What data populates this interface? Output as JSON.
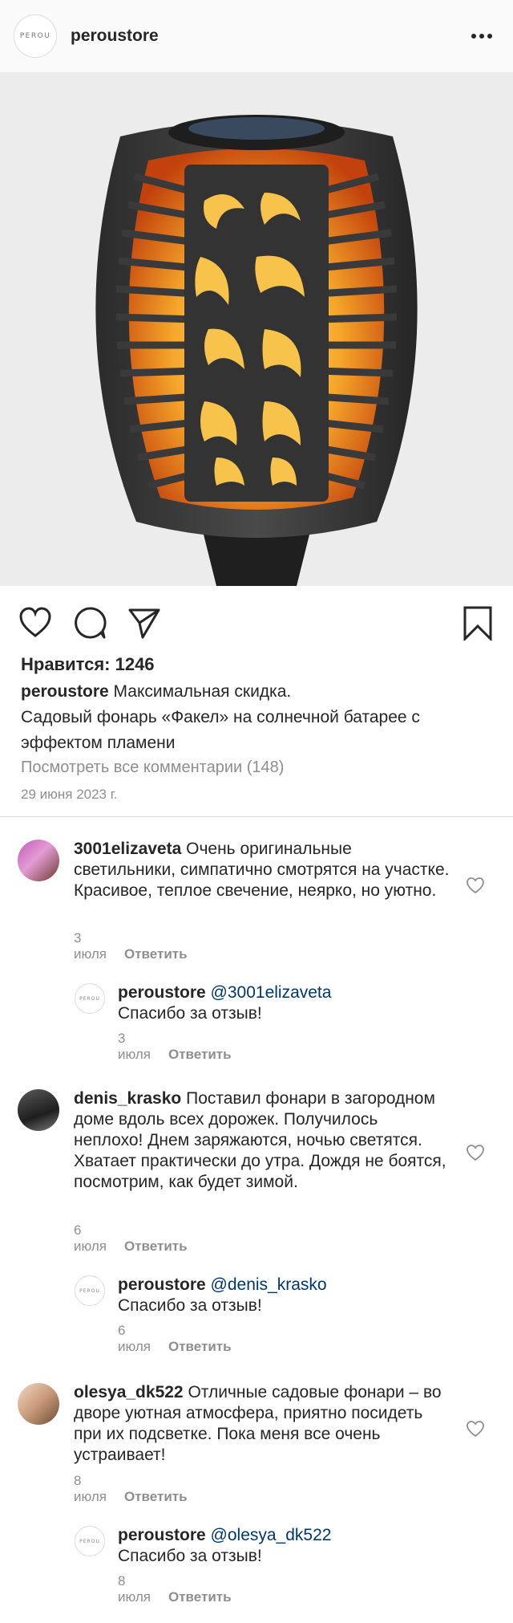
{
  "header": {
    "username": "peroustore",
    "logo_text": "PEROU",
    "more_icon": "more-horizontal-icon"
  },
  "post": {
    "likes_label": "Нравится: 1246",
    "caption_user": "peroustore",
    "caption_text": "Максимальная скидка.\nСадовый фонарь «Факел» на солнечной батарее с эффектом пламени",
    "view_all": "Посмотреть все комментарии (148)",
    "date": "29 июня 2023 г."
  },
  "actions": {
    "like_icon": "heart-icon",
    "comment_icon": "comment-icon",
    "share_icon": "send-icon",
    "save_icon": "bookmark-icon"
  },
  "comments": [
    {
      "user": "3001elizaveta",
      "text": "Очень оригинальные светильники, симпатично смотрятся на участке. Красивое, теплое свечение, неярко, но уютно.",
      "date": "3 июля",
      "reply": "Ответить"
    },
    {
      "user": "peroustore",
      "mention": "@3001elizaveta",
      "text": "Спасибо за отзыв!",
      "date": "3 июля",
      "reply": "Ответить"
    },
    {
      "user": "denis_krasko",
      "text": "Поставил фонари в загородном доме вдоль всех дорожек. Получилось неплохо! Днем заряжаются, ночью светятся. Хватает практически до утра. Дождя не боятся, посмотрим, как будет зимой.",
      "date": "6 июля",
      "reply": "Ответить"
    },
    {
      "user": "peroustore",
      "mention": "@denis_krasko",
      "text": "Спасибо за отзыв!",
      "date": "6 июля",
      "reply": "Ответить"
    },
    {
      "user": "olesya_dk522",
      "text": "Отличные садовые фонари – во дворе уютная атмосфера, приятно посидеть при их подсветке. Пока меня все очень устраивает!",
      "date": "8 июля",
      "reply": "Ответить"
    },
    {
      "user": "peroustore",
      "mention": "@olesya_dk522",
      "text": "Спасибо за отзыв!",
      "date": "8 июля",
      "reply": "Ответить"
    }
  ],
  "colors": {
    "secondary_text": "#8e8e8e",
    "mention": "#00376b",
    "divider": "#dbdbdb"
  }
}
